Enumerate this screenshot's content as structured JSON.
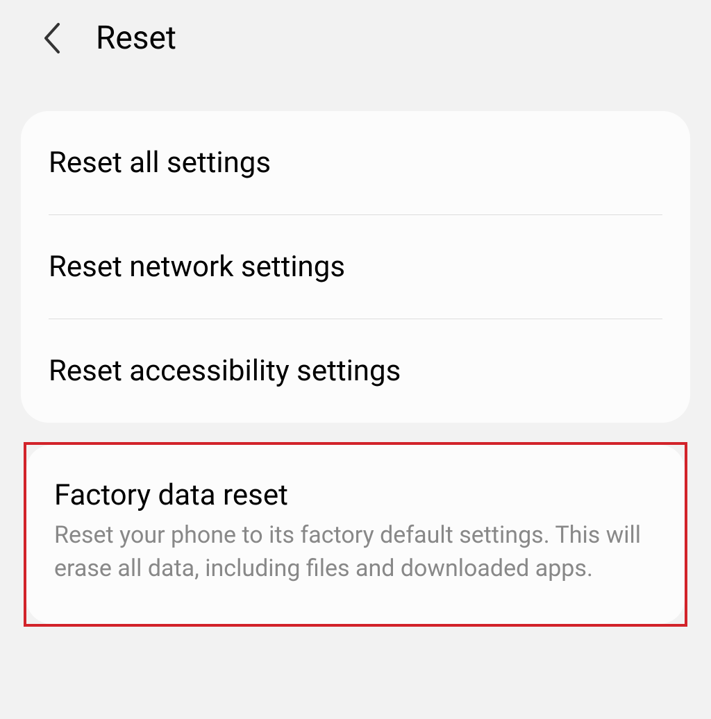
{
  "header": {
    "title": "Reset"
  },
  "section1": {
    "items": [
      {
        "title": "Reset all settings"
      },
      {
        "title": "Reset network settings"
      },
      {
        "title": "Reset accessibility settings"
      }
    ]
  },
  "section2": {
    "item": {
      "title": "Factory data reset",
      "description": "Reset your phone to its factory default settings. This will erase all data, including files and downloaded apps."
    }
  }
}
